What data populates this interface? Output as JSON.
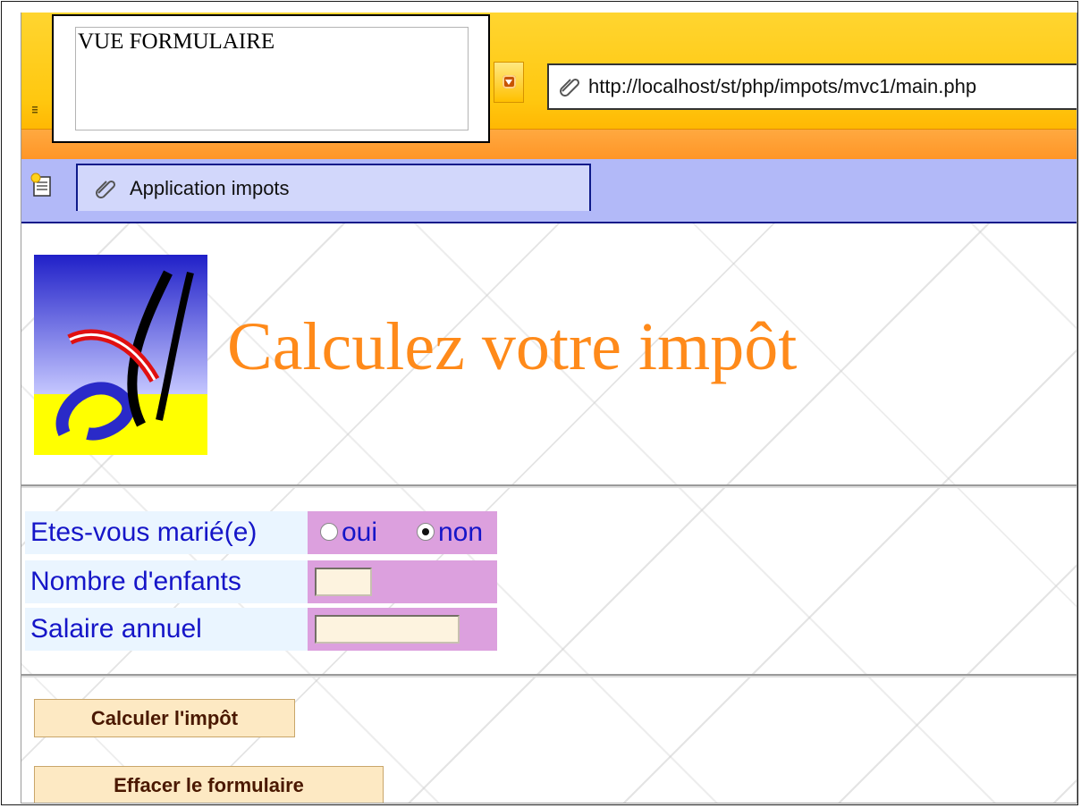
{
  "overlay": {
    "label": "VUE FORMULAIRE"
  },
  "browser": {
    "address_url": "http://localhost/st/php/impots/mvc1/main.php",
    "tab_title": "Application impots"
  },
  "page": {
    "title": "Calculez votre impôt",
    "form": {
      "married_label": "Etes-vous marié(e)",
      "married_options": [
        "oui",
        "non"
      ],
      "married_selected": "non",
      "children_label": "Nombre d'enfants",
      "children_value": "",
      "salary_label": "Salaire annuel",
      "salary_value": ""
    },
    "buttons": {
      "calculate": "Calculer l'impôt",
      "reset": "Effacer le formulaire"
    }
  },
  "colors": {
    "toolbar": "#ffc810",
    "toolbar_strip": "#ff9526",
    "tabbar": "#b2b9f8",
    "title": "#ff8a1a",
    "label_text": "#1515c8",
    "label_bg": "#eaf5ff",
    "input_cell_bg": "#dca0de",
    "button_bg": "#fde9c3",
    "button_text": "#4a1800"
  },
  "icons": [
    "clip-icon",
    "new-tab-icon",
    "menu-arrow-icon",
    "logo-icon"
  ]
}
